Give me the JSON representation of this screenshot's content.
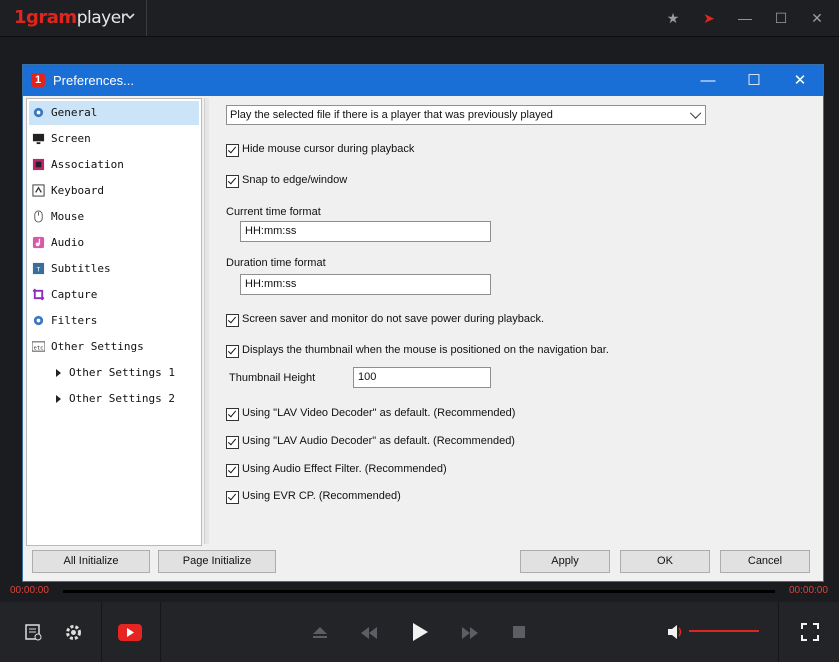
{
  "app": {
    "brand": "1gram",
    "name": "player"
  },
  "dialog": {
    "title": "Preferences..."
  },
  "sidebar": {
    "items": [
      {
        "label": "General",
        "icon": "gear-icon",
        "selected": true
      },
      {
        "label": "Screen",
        "icon": "monitor-icon"
      },
      {
        "label": "Association",
        "icon": "film-icon"
      },
      {
        "label": "Keyboard",
        "icon": "keyboard-icon"
      },
      {
        "label": "Mouse",
        "icon": "mouse-icon"
      },
      {
        "label": "Audio",
        "icon": "music-icon"
      },
      {
        "label": "Subtitles",
        "icon": "subtitles-icon"
      },
      {
        "label": "Capture",
        "icon": "crop-icon"
      },
      {
        "label": "Filters",
        "icon": "gear-icon"
      },
      {
        "label": "Other Settings",
        "icon": "etc-icon"
      },
      {
        "label": "Other Settings 1",
        "icon": "triangle-icon"
      },
      {
        "label": "Other Settings 2",
        "icon": "triangle-icon"
      }
    ]
  },
  "general": {
    "play_mode": "Play the selected file if there is a player that was previously played",
    "hide_cursor": "Hide mouse cursor during playback",
    "snap_edge": "Snap to edge/window",
    "current_time_label": "Current time format",
    "current_time_value": "HH:mm:ss",
    "duration_time_label": "Duration time format",
    "duration_time_value": "HH:mm:ss",
    "screen_saver": "Screen saver and monitor do not save power during playback.",
    "thumbnail": "Displays the thumbnail when the mouse is positioned on the navigation bar.",
    "thumbnail_height_label": "Thumbnail Height",
    "thumbnail_height_value": "100",
    "lav_video": "Using \"LAV Video Decoder\" as default. (Recommended)",
    "lav_audio": "Using \"LAV Audio Decoder\" as default. (Recommended)",
    "audio_effect": "Using Audio Effect Filter. (Recommended)",
    "evr_cp": "Using EVR CP. (Recommended)"
  },
  "buttons": {
    "all_init": "All Initialize",
    "page_init": "Page Initialize",
    "apply": "Apply",
    "ok": "OK",
    "cancel": "Cancel"
  },
  "player": {
    "time_current": "00:00:00",
    "time_total": "00:00:00",
    "volume": 1.0
  },
  "colors": {
    "accent": "#1a6fd6",
    "brand": "#e0251f",
    "time": "#d8453b"
  }
}
